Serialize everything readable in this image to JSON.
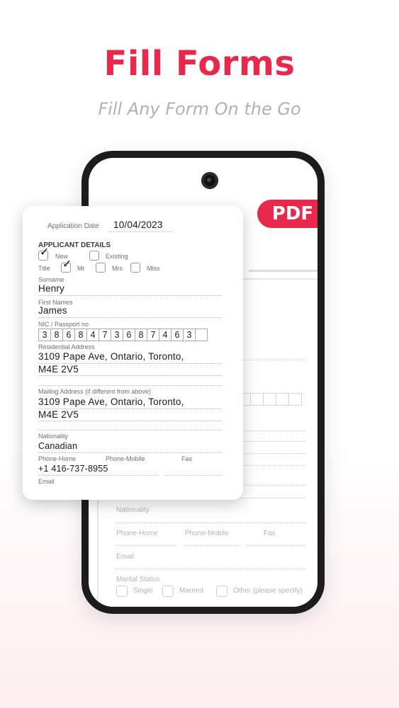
{
  "hero": {
    "title": "Fill Forms",
    "subtitle": "Fill Any Form On the Go"
  },
  "badge": {
    "label": "PDF"
  },
  "background_form": {
    "labels": {
      "nationality": "Nationality",
      "phone_home": "Phone-Home",
      "phone_mobile": "Phone-Mobile",
      "fax": "Fax",
      "email": "Email",
      "marital_status": "Marital Status",
      "single": "Single",
      "married": "Married",
      "other": "Other (please specify)"
    }
  },
  "form": {
    "application_date_label": "Application Date",
    "application_date": "10/04/2023",
    "section_title": "APPLICANT DETAILS",
    "new_label": "New",
    "existing_label": "Existing",
    "title_label": "Title",
    "mr_label": "Mr",
    "mrs_label": "Mrs",
    "miss_label": "Miss",
    "surname_label": "Surname",
    "surname": "Henry",
    "first_names_label": "First Names",
    "first_names": "James",
    "nic_label": "NIC / Passport no",
    "nic_digits": [
      "3",
      "8",
      "6",
      "8",
      "4",
      "7",
      "3",
      "6",
      "8",
      "7",
      "4",
      "6",
      "3",
      ""
    ],
    "residential_label": "Residential Address",
    "residential_line1": "3109 Pape Ave, Ontario, Toronto,",
    "residential_line2": "M4E 2V5",
    "mailing_label": "Mailing Address (if different from above)",
    "mailing_line1": "3109 Pape Ave, Ontario, Toronto,",
    "mailing_line2": "M4E 2V5",
    "nationality_label": "Nationality",
    "nationality": "Canadian",
    "phone_home_label": "Phone-Home",
    "phone_home": "+1 416-737-8955",
    "phone_mobile_label": "Phone-Mobile",
    "fax_label": "Fax",
    "email_label": "Email"
  },
  "colors": {
    "accent": "#e8294c",
    "subtitle": "#aeb1b6",
    "phone_frame": "#1c1c1e"
  }
}
